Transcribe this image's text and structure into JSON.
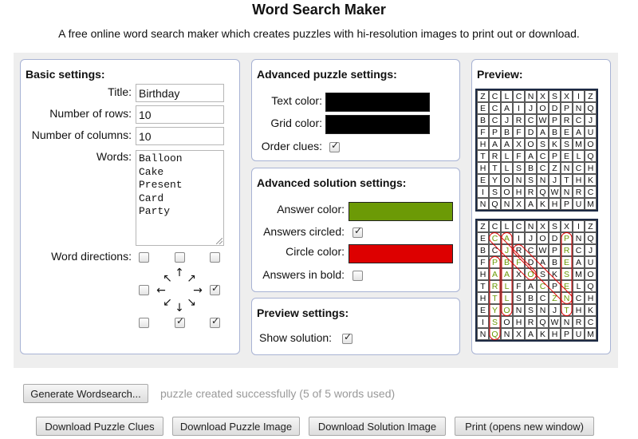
{
  "header": {
    "title": "Word Search Maker",
    "subtitle": "A free online word search maker which creates puzzles with hi-resolution images to print out or download."
  },
  "basic": {
    "heading": "Basic settings:",
    "title_label": "Title:",
    "title_value": "Birthday",
    "rows_label": "Number of rows:",
    "rows_value": "10",
    "cols_label": "Number of columns:",
    "cols_value": "10",
    "words_label": "Words:",
    "words_value": "Balloon\nCake\nPresent\nCard\nParty",
    "directions_label": "Word directions:",
    "directions_checked": {
      "up_left": false,
      "up": false,
      "up_right": false,
      "left": false,
      "right": true,
      "down_left": false,
      "down": true,
      "down_right": true
    }
  },
  "advanced_puzzle": {
    "heading": "Advanced puzzle settings:",
    "text_color_label": "Text color:",
    "text_color": "#000000",
    "grid_color_label": "Grid color:",
    "grid_color": "#000000",
    "order_clues_label": "Order clues:",
    "order_clues": true
  },
  "advanced_solution": {
    "heading": "Advanced solution settings:",
    "answer_color_label": "Answer color:",
    "answer_color": "#6c9a06",
    "answers_circled_label": "Answers circled:",
    "answers_circled": true,
    "circle_color_label": "Circle color:",
    "circle_color": "#dd0000",
    "answers_bold_label": "Answers in bold:",
    "answers_bold": false
  },
  "preview_settings": {
    "heading": "Preview settings:",
    "show_solution_label": "Show solution:",
    "show_solution": true
  },
  "preview": {
    "heading": "Preview:",
    "grid": [
      [
        "Z",
        "C",
        "L",
        "C",
        "N",
        "X",
        "S",
        "X",
        "I",
        "Z"
      ],
      [
        "E",
        "C",
        "A",
        "I",
        "J",
        "O",
        "D",
        "P",
        "N",
        "Q"
      ],
      [
        "B",
        "C",
        "J",
        "R",
        "C",
        "W",
        "P",
        "R",
        "C",
        "J"
      ],
      [
        "F",
        "P",
        "B",
        "F",
        "D",
        "A",
        "B",
        "E",
        "A",
        "U"
      ],
      [
        "H",
        "A",
        "A",
        "X",
        "O",
        "S",
        "K",
        "S",
        "M",
        "O"
      ],
      [
        "T",
        "R",
        "L",
        "F",
        "A",
        "C",
        "P",
        "E",
        "L",
        "Q"
      ],
      [
        "H",
        "T",
        "L",
        "S",
        "B",
        "C",
        "Z",
        "N",
        "C",
        "H"
      ],
      [
        "E",
        "Y",
        "O",
        "N",
        "S",
        "N",
        "J",
        "T",
        "H",
        "K"
      ],
      [
        "I",
        "S",
        "O",
        "H",
        "R",
        "Q",
        "W",
        "N",
        "R",
        "C"
      ],
      [
        "N",
        "Q",
        "N",
        "X",
        "A",
        "K",
        "H",
        "P",
        "U",
        "M"
      ]
    ],
    "solution_answer_cells": [
      [
        1,
        1
      ],
      [
        2,
        2
      ],
      [
        3,
        3
      ],
      [
        4,
        4
      ],
      [
        1,
        2
      ],
      [
        2,
        2
      ],
      [
        3,
        2
      ],
      [
        4,
        2
      ],
      [
        5,
        2
      ],
      [
        6,
        2
      ],
      [
        7,
        2
      ],
      [
        3,
        1
      ],
      [
        4,
        1
      ],
      [
        5,
        1
      ],
      [
        6,
        1
      ],
      [
        7,
        1
      ],
      [
        8,
        1
      ],
      [
        9,
        1
      ],
      [
        1,
        7
      ],
      [
        2,
        7
      ],
      [
        3,
        7
      ],
      [
        4,
        7
      ],
      [
        5,
        7
      ],
      [
        6,
        7
      ],
      [
        7,
        7
      ],
      [
        3,
        3
      ],
      [
        4,
        4
      ],
      [
        5,
        5
      ],
      [
        6,
        6
      ]
    ],
    "solution_circles": [
      {
        "from": [
          1,
          1
        ],
        "to": [
          4,
          4
        ]
      },
      {
        "from": [
          1,
          2
        ],
        "to": [
          7,
          2
        ]
      },
      {
        "from": [
          3,
          1
        ],
        "to": [
          9,
          1
        ]
      },
      {
        "from": [
          1,
          7
        ],
        "to": [
          7,
          7
        ]
      },
      {
        "from": [
          2,
          3
        ],
        "to": [
          6,
          7
        ]
      }
    ]
  },
  "buttons": {
    "generate": "Generate Wordsearch...",
    "download_clues": "Download Puzzle Clues",
    "download_puzzle": "Download Puzzle Image",
    "download_solution": "Download Solution Image",
    "print": "Print (opens new window)"
  },
  "status": "puzzle created successfully (5 of 5 words used)"
}
